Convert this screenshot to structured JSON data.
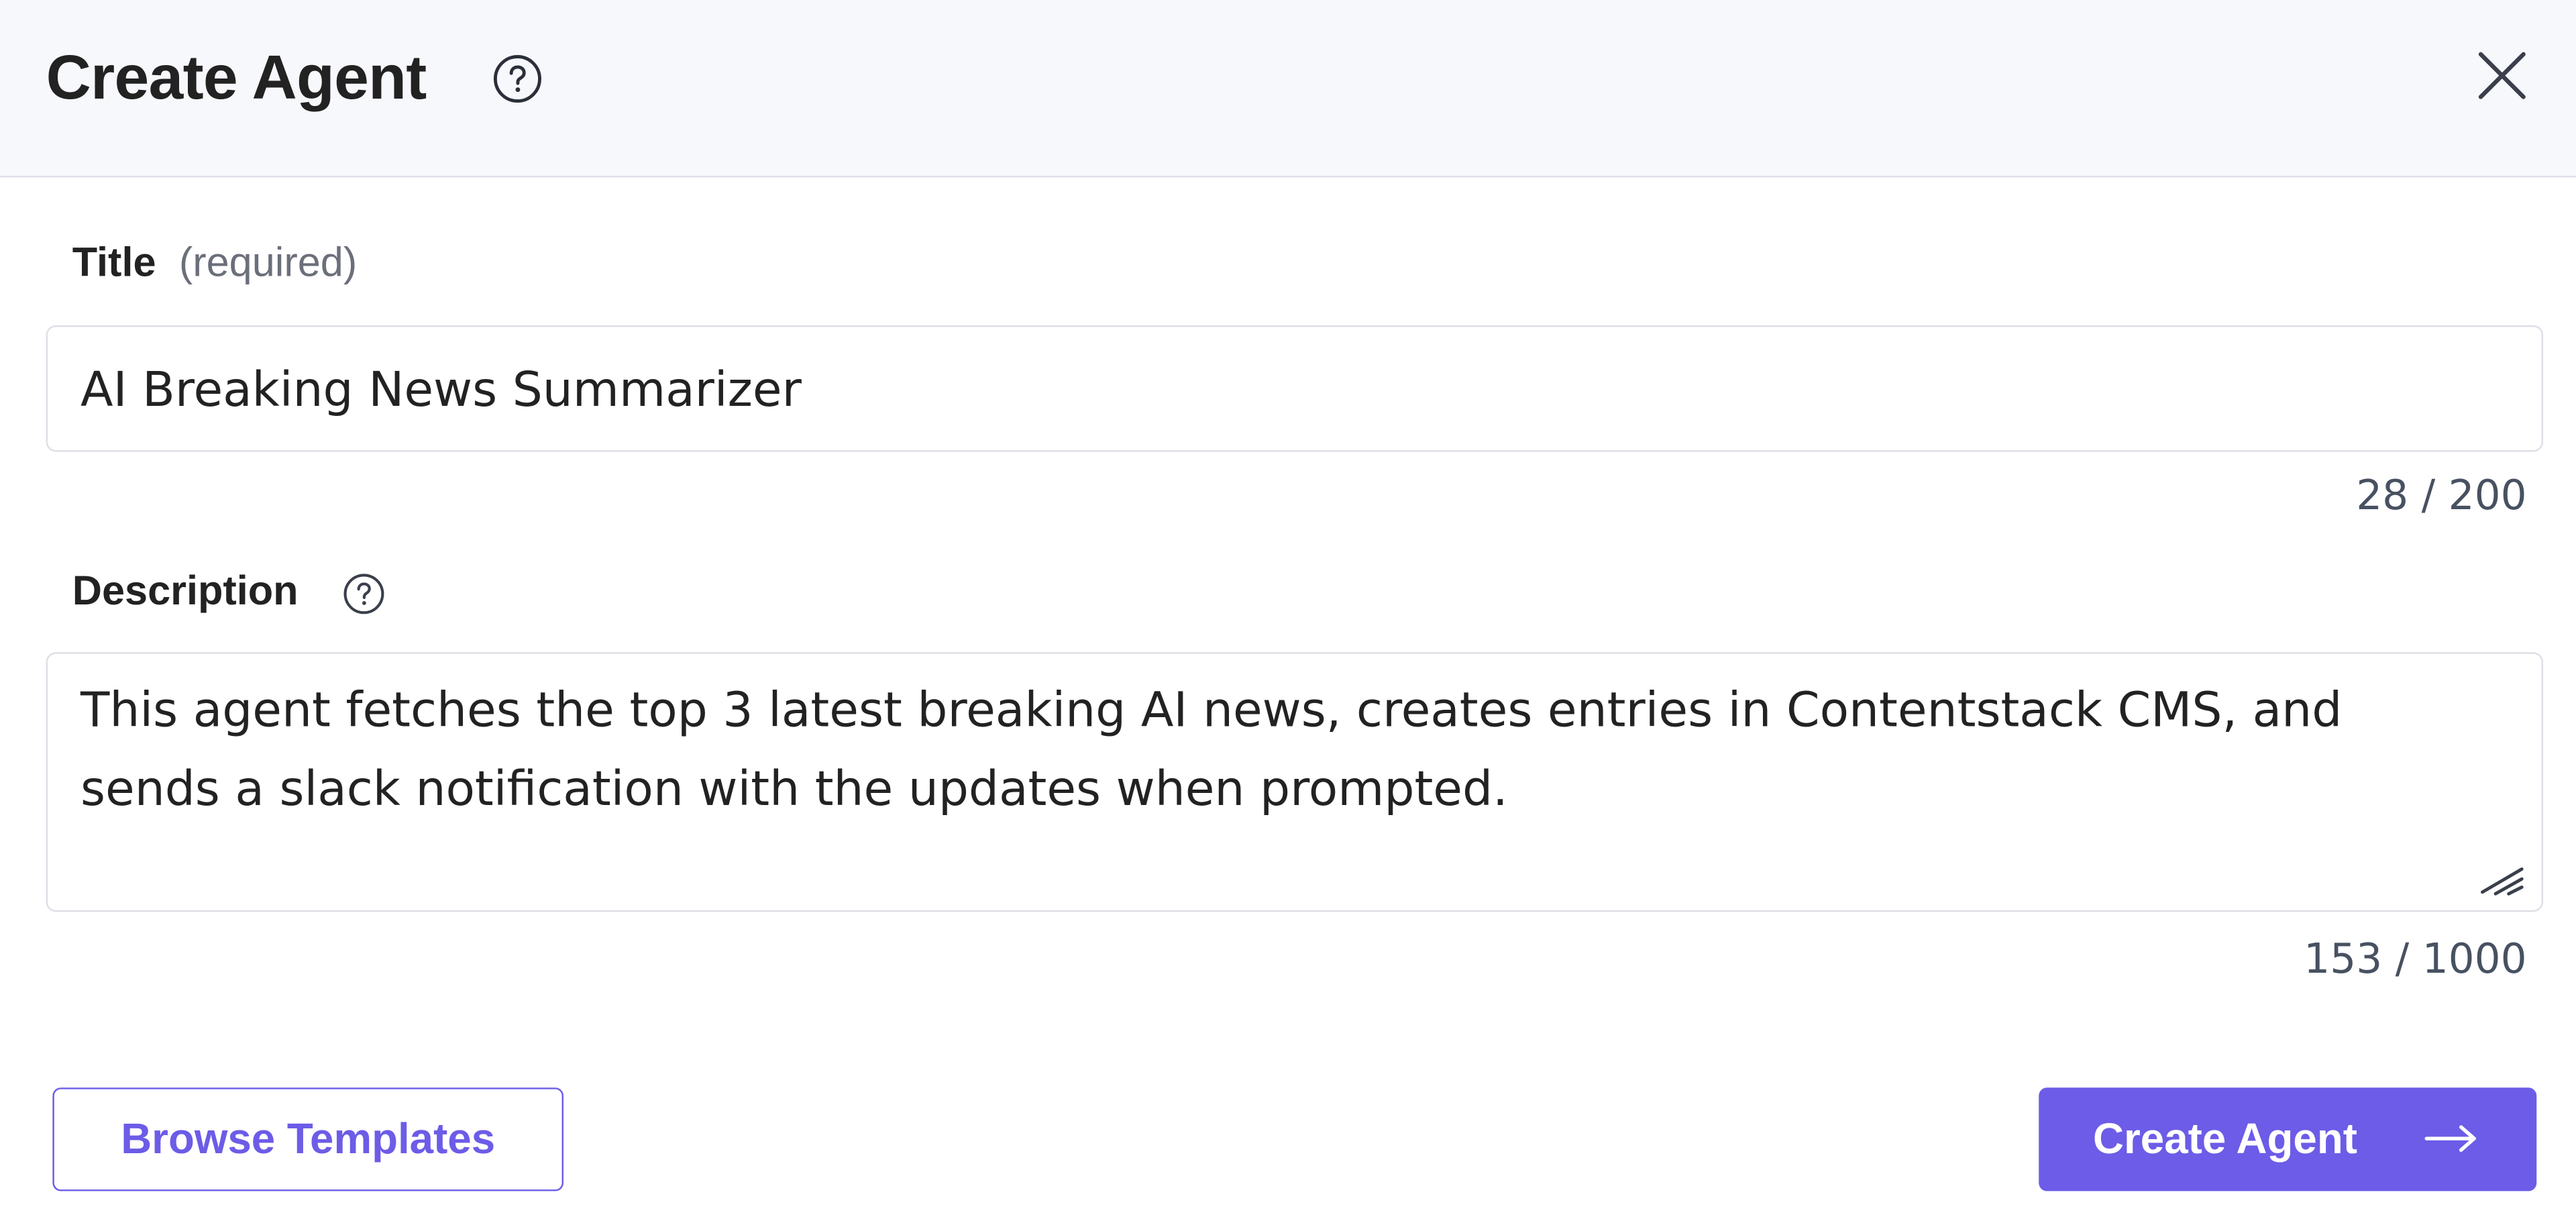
{
  "dialog": {
    "title": "Create Agent",
    "help_icon": "question-circle-icon",
    "close_icon": "close-x-icon"
  },
  "title_field": {
    "label": "Title",
    "hint": "(required)",
    "value": "AI Breaking News Summarizer",
    "counter": "28 / 200"
  },
  "description_field": {
    "label": "Description",
    "help_icon": "question-circle-icon",
    "value": "This agent fetches the top 3 latest breaking AI news, creates entries in Contentstack CMS, and sends a slack notification with the updates when prompted.",
    "counter": "153 / 1000",
    "resize_icon": "resize-grip-icon"
  },
  "footer": {
    "browse_label": "Browse Templates",
    "create_label": "Create Agent",
    "create_icon": "arrow-right-icon"
  },
  "colors": {
    "accent": "#6c5ce7",
    "header_bg": "#f7f8fc",
    "border": "#dedfe6",
    "counter_text": "#475161",
    "hint_text": "#6b6f7a"
  }
}
